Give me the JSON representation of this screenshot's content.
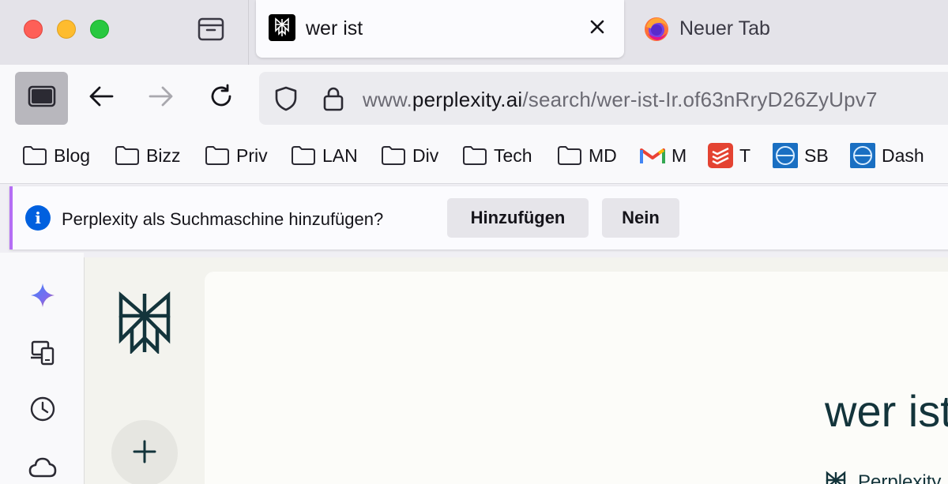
{
  "browser": {
    "tabs": [
      {
        "title": "wer ist",
        "favicon": "perplexity-icon",
        "active": true
      },
      {
        "title": "Neuer Tab",
        "favicon": "firefox-icon",
        "active": false
      }
    ],
    "url": {
      "prefix": "www.",
      "domain": "perplexity.ai",
      "path": "/search/wer-ist-Ir.of63nRryD26ZyUpv7"
    }
  },
  "bookmarks": [
    {
      "label": "Blog",
      "icon": "folder-icon"
    },
    {
      "label": "Bizz",
      "icon": "folder-icon"
    },
    {
      "label": "Priv",
      "icon": "folder-icon"
    },
    {
      "label": "LAN",
      "icon": "folder-icon"
    },
    {
      "label": "Div",
      "icon": "folder-icon"
    },
    {
      "label": "Tech",
      "icon": "folder-icon"
    },
    {
      "label": "MD",
      "icon": "folder-icon"
    },
    {
      "label": "M",
      "icon": "gmail-icon"
    },
    {
      "label": "T",
      "icon": "todoist-icon"
    },
    {
      "label": "SB",
      "icon": "sb-icon"
    },
    {
      "label": "Dash",
      "icon": "dash-icon"
    }
  ],
  "notification": {
    "message": "Perplexity als Suchmaschine hinzufügen?",
    "add_label": "Hinzufügen",
    "no_label": "Nein"
  },
  "page": {
    "query_title": "wer ist",
    "source_label": "Perplexity"
  },
  "colors": {
    "accent": "#13343b",
    "notification_icon": "#0060df"
  }
}
